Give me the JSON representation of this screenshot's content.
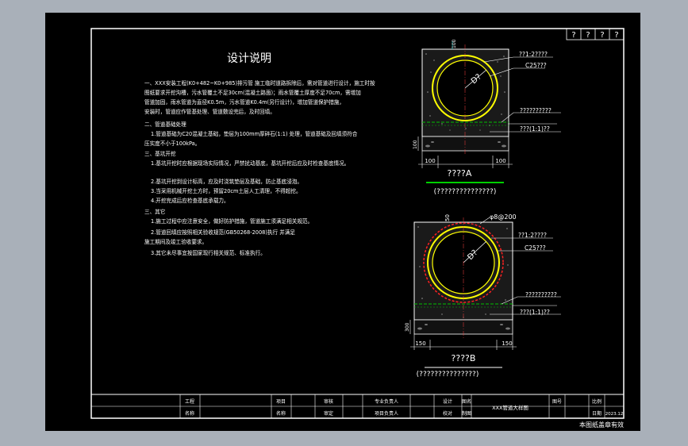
{
  "window": {
    "title": ""
  },
  "drawing": {
    "title": "设计说明",
    "corner_marks": [
      "?",
      "?",
      "?",
      "?"
    ],
    "notes": [
      "一、XXX安装工程(K0+482~K0+985)排污管    施工临时道路拆除后，需对管道进行设计，施工时按",
      "图纸要求开挖沟槽，污水管覆土不足30cm(混凝土路面)；雨水管覆土厚度不足70cm，需增加",
      "管道加固，雨水管道为直径K0.5m，污水管道K0.4m(另行设计)，增加管道保护措施，",
      "安装时，管道应作管基处理、管道敷设完后，及时回填。",
      "二、管道基础处理",
      "1.管道基础为C20混凝土基础，垫层为100mm厚碎石(1:1)    处理，管道基础及回填须符合",
      "压实度不小于100kPa。",
      "三、基坑开挖",
      "1.基坑开挖时应根据现场实际情况，严禁扰动基底，基坑开挖后应及时检查基底情况。",
      "2.基坑开挖到设计标高，应及时浇筑垫层及基础，防止基底浸泡。",
      "3.当采用机械开挖土方时，预留20cm土层人工清理，不得超挖。",
      "4.开挖完成后应检查基底承载力。",
      "三、其它",
      "1.施工过程中应注意安全，做好防护措施，管道施工须满足相关规范。",
      "2.管道回填应按照相关验收规范(GB50268-2008)执行    并满足",
      "施工期间及竣工验收要求。",
      "3.其它未尽事宜按国家现行相关规范、标准执行。"
    ],
    "section_a": {
      "title": "????A",
      "subtitle": "(???????????????)",
      "dim_top": "100",
      "dim_side": "100",
      "dim_bottom_left": "100",
      "dim_bottom_right": "100",
      "pipe_label": "D?",
      "labels": [
        "??1:2????",
        "C25???",
        "??????????",
        "???(1:1)??"
      ]
    },
    "section_b": {
      "title": "????B",
      "subtitle": "(???????????????)",
      "dim_top_left": "50",
      "dim_top_right": "φ8@200",
      "dim_side": "300",
      "dim_bottom_left": "150",
      "dim_bottom_right": "150",
      "pipe_label": "D?",
      "labels": [
        "??1:2????",
        "C25???",
        "??????????",
        "???(1:1)??"
      ]
    },
    "title_block": {
      "cells": [
        "工程",
        "项目",
        "审核",
        "专业负责人",
        "设计",
        "图名",
        "图号",
        "比例",
        "日期"
      ],
      "row2": [
        "名称",
        "名称",
        "审定",
        "项目负责人",
        "校对",
        "制图"
      ],
      "drawing_name": "XXX管道大样图",
      "date": "2023.12"
    },
    "footer_stamp": "本图纸盖章有效"
  },
  "colors": {
    "background": "#a9b0b9",
    "sheet": "#000000",
    "lines": "#ffffff",
    "pipe": "#ffff00",
    "accent_green": "#00c000",
    "rebar_red": "#ff2020",
    "dim_cyan": "#00e0e0"
  }
}
